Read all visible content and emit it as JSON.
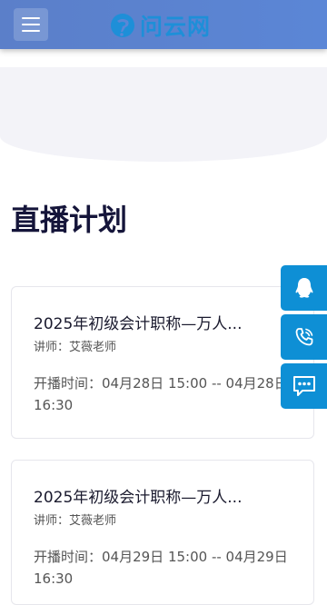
{
  "header": {
    "logo_text": "问云网",
    "menu_icon": "hamburger-icon",
    "logo_icon": "wenyun-logo-icon"
  },
  "section": {
    "title": "直播计划"
  },
  "courses": [
    {
      "title": "2025年初级会计职称—万人...",
      "teacher": "讲师：艾薇老师",
      "time": "开播时间：04月28日 15:00 -- 04月28日 16:30"
    },
    {
      "title": "2025年初级会计职称—万人...",
      "teacher": "讲师：艾薇老师",
      "time": "开播时间：04月29日 15:00 -- 04月29日 16:30"
    }
  ],
  "float_actions": [
    {
      "icon": "qq-penguin-icon"
    },
    {
      "icon": "phone-icon"
    },
    {
      "icon": "chat-message-icon"
    }
  ],
  "colors": {
    "header_bg": "#5b7fc9",
    "brand_blue": "#1e8fd8",
    "float_btn_bg": "#0e8fd5",
    "title_text": "#15153a"
  }
}
